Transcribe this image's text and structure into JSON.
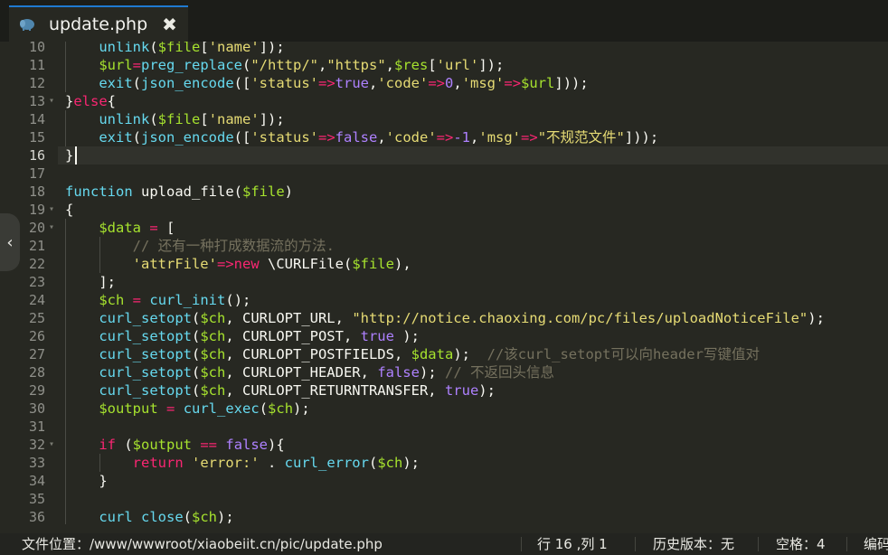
{
  "tab": {
    "title": "update.php",
    "icon": "php-elephant-icon",
    "close_glyph": "✖"
  },
  "gutter": {
    "line_numbers": [
      "10",
      "11",
      "12",
      "13",
      "14",
      "15",
      "16",
      "17",
      "18",
      "19",
      "20",
      "21",
      "22",
      "23",
      "24",
      "25",
      "26",
      "27",
      "28",
      "29",
      "30",
      "31",
      "32",
      "33",
      "34",
      "35",
      "36"
    ],
    "fold_lines": [
      "13",
      "19",
      "20",
      "32"
    ]
  },
  "editor": {
    "active_line": "16",
    "lines": [
      {
        "num": "10",
        "segments": [
          {
            "t": "    ",
            "c": "p"
          },
          {
            "t": "unlink",
            "c": "f"
          },
          {
            "t": "(",
            "c": "p"
          },
          {
            "t": "$file",
            "c": "v"
          },
          {
            "t": "[",
            "c": "p"
          },
          {
            "t": "'name'",
            "c": "s"
          },
          {
            "t": "]);",
            "c": "p"
          }
        ]
      },
      {
        "num": "11",
        "segments": [
          {
            "t": "    ",
            "c": "p"
          },
          {
            "t": "$url",
            "c": "v"
          },
          {
            "t": "=",
            "c": "k"
          },
          {
            "t": "preg_replace",
            "c": "f"
          },
          {
            "t": "(",
            "c": "p"
          },
          {
            "t": "\"/http/\"",
            "c": "s"
          },
          {
            "t": ",",
            "c": "p"
          },
          {
            "t": "\"https\"",
            "c": "s"
          },
          {
            "t": ",",
            "c": "p"
          },
          {
            "t": "$res",
            "c": "v"
          },
          {
            "t": "[",
            "c": "p"
          },
          {
            "t": "'url'",
            "c": "s"
          },
          {
            "t": "]);",
            "c": "p"
          }
        ]
      },
      {
        "num": "12",
        "segments": [
          {
            "t": "    ",
            "c": "p"
          },
          {
            "t": "exit",
            "c": "f"
          },
          {
            "t": "(",
            "c": "p"
          },
          {
            "t": "json_encode",
            "c": "f"
          },
          {
            "t": "([",
            "c": "p"
          },
          {
            "t": "'status'",
            "c": "s"
          },
          {
            "t": "=>",
            "c": "k"
          },
          {
            "t": "true",
            "c": "n"
          },
          {
            "t": ",",
            "c": "p"
          },
          {
            "t": "'code'",
            "c": "s"
          },
          {
            "t": "=>",
            "c": "k"
          },
          {
            "t": "0",
            "c": "n"
          },
          {
            "t": ",",
            "c": "p"
          },
          {
            "t": "'msg'",
            "c": "s"
          },
          {
            "t": "=>",
            "c": "k"
          },
          {
            "t": "$url",
            "c": "v"
          },
          {
            "t": "]));",
            "c": "p"
          }
        ]
      },
      {
        "num": "13",
        "segments": [
          {
            "t": "}",
            "c": "p"
          },
          {
            "t": "else",
            "c": "k"
          },
          {
            "t": "{",
            "c": "p"
          }
        ]
      },
      {
        "num": "14",
        "segments": [
          {
            "t": "    ",
            "c": "p"
          },
          {
            "t": "unlink",
            "c": "f"
          },
          {
            "t": "(",
            "c": "p"
          },
          {
            "t": "$file",
            "c": "v"
          },
          {
            "t": "[",
            "c": "p"
          },
          {
            "t": "'name'",
            "c": "s"
          },
          {
            "t": "]);",
            "c": "p"
          }
        ]
      },
      {
        "num": "15",
        "segments": [
          {
            "t": "    ",
            "c": "p"
          },
          {
            "t": "exit",
            "c": "f"
          },
          {
            "t": "(",
            "c": "p"
          },
          {
            "t": "json_encode",
            "c": "f"
          },
          {
            "t": "([",
            "c": "p"
          },
          {
            "t": "'status'",
            "c": "s"
          },
          {
            "t": "=>",
            "c": "k"
          },
          {
            "t": "false",
            "c": "n"
          },
          {
            "t": ",",
            "c": "p"
          },
          {
            "t": "'code'",
            "c": "s"
          },
          {
            "t": "=>",
            "c": "k"
          },
          {
            "t": "-1",
            "c": "n"
          },
          {
            "t": ",",
            "c": "p"
          },
          {
            "t": "'msg'",
            "c": "s"
          },
          {
            "t": "=>",
            "c": "k"
          },
          {
            "t": "\"不规范文件\"",
            "c": "s"
          },
          {
            "t": "]));",
            "c": "p"
          }
        ]
      },
      {
        "num": "16",
        "segments": [
          {
            "t": "}",
            "c": "p"
          }
        ]
      },
      {
        "num": "17",
        "segments": []
      },
      {
        "num": "18",
        "segments": [
          {
            "t": "function",
            "c": "f"
          },
          {
            "t": " ",
            "c": "p"
          },
          {
            "t": "upload_file",
            "c": "p"
          },
          {
            "t": "(",
            "c": "p"
          },
          {
            "t": "$file",
            "c": "v"
          },
          {
            "t": ")",
            "c": "p"
          }
        ]
      },
      {
        "num": "19",
        "segments": [
          {
            "t": "{",
            "c": "p"
          }
        ]
      },
      {
        "num": "20",
        "segments": [
          {
            "t": "    ",
            "c": "p"
          },
          {
            "t": "$data",
            "c": "v"
          },
          {
            "t": " ",
            "c": "p"
          },
          {
            "t": "=",
            "c": "k"
          },
          {
            "t": " [",
            "c": "p"
          }
        ]
      },
      {
        "num": "21",
        "segments": [
          {
            "t": "        ",
            "c": "p"
          },
          {
            "t": "// 还有一种打成数据流的方法.",
            "c": "c"
          }
        ]
      },
      {
        "num": "22",
        "segments": [
          {
            "t": "        ",
            "c": "p"
          },
          {
            "t": "'attrFile'",
            "c": "s"
          },
          {
            "t": "=>",
            "c": "k"
          },
          {
            "t": "new",
            "c": "k"
          },
          {
            "t": " \\CURLFile(",
            "c": "p"
          },
          {
            "t": "$file",
            "c": "v"
          },
          {
            "t": "),",
            "c": "p"
          }
        ]
      },
      {
        "num": "23",
        "segments": [
          {
            "t": "    ",
            "c": "p"
          },
          {
            "t": "];",
            "c": "p"
          }
        ]
      },
      {
        "num": "24",
        "segments": [
          {
            "t": "    ",
            "c": "p"
          },
          {
            "t": "$ch",
            "c": "v"
          },
          {
            "t": " ",
            "c": "p"
          },
          {
            "t": "=",
            "c": "k"
          },
          {
            "t": " ",
            "c": "p"
          },
          {
            "t": "curl_init",
            "c": "f"
          },
          {
            "t": "();",
            "c": "p"
          }
        ]
      },
      {
        "num": "25",
        "segments": [
          {
            "t": "    ",
            "c": "p"
          },
          {
            "t": "curl_setopt",
            "c": "f"
          },
          {
            "t": "(",
            "c": "p"
          },
          {
            "t": "$ch",
            "c": "v"
          },
          {
            "t": ", CURLOPT_URL, ",
            "c": "p"
          },
          {
            "t": "\"http://notice.chaoxing.com/pc/files/uploadNoticeFile\"",
            "c": "s"
          },
          {
            "t": ");",
            "c": "p"
          }
        ]
      },
      {
        "num": "26",
        "segments": [
          {
            "t": "    ",
            "c": "p"
          },
          {
            "t": "curl_setopt",
            "c": "f"
          },
          {
            "t": "(",
            "c": "p"
          },
          {
            "t": "$ch",
            "c": "v"
          },
          {
            "t": ", CURLOPT_POST, ",
            "c": "p"
          },
          {
            "t": "true",
            "c": "n"
          },
          {
            "t": " );",
            "c": "p"
          }
        ]
      },
      {
        "num": "27",
        "segments": [
          {
            "t": "    ",
            "c": "p"
          },
          {
            "t": "curl_setopt",
            "c": "f"
          },
          {
            "t": "(",
            "c": "p"
          },
          {
            "t": "$ch",
            "c": "v"
          },
          {
            "t": ", CURLOPT_POSTFIELDS, ",
            "c": "p"
          },
          {
            "t": "$data",
            "c": "v"
          },
          {
            "t": ");  ",
            "c": "p"
          },
          {
            "t": "//该curl_setopt可以向header写键值对",
            "c": "c"
          }
        ]
      },
      {
        "num": "28",
        "segments": [
          {
            "t": "    ",
            "c": "p"
          },
          {
            "t": "curl_setopt",
            "c": "f"
          },
          {
            "t": "(",
            "c": "p"
          },
          {
            "t": "$ch",
            "c": "v"
          },
          {
            "t": ", CURLOPT_HEADER, ",
            "c": "p"
          },
          {
            "t": "false",
            "c": "n"
          },
          {
            "t": "); ",
            "c": "p"
          },
          {
            "t": "// 不返回头信息",
            "c": "c"
          }
        ]
      },
      {
        "num": "29",
        "segments": [
          {
            "t": "    ",
            "c": "p"
          },
          {
            "t": "curl_setopt",
            "c": "f"
          },
          {
            "t": "(",
            "c": "p"
          },
          {
            "t": "$ch",
            "c": "v"
          },
          {
            "t": ", CURLOPT_RETURNTRANSFER, ",
            "c": "p"
          },
          {
            "t": "true",
            "c": "n"
          },
          {
            "t": ");",
            "c": "p"
          }
        ]
      },
      {
        "num": "30",
        "segments": [
          {
            "t": "    ",
            "c": "p"
          },
          {
            "t": "$output",
            "c": "v"
          },
          {
            "t": " ",
            "c": "p"
          },
          {
            "t": "=",
            "c": "k"
          },
          {
            "t": " ",
            "c": "p"
          },
          {
            "t": "curl_exec",
            "c": "f"
          },
          {
            "t": "(",
            "c": "p"
          },
          {
            "t": "$ch",
            "c": "v"
          },
          {
            "t": ");",
            "c": "p"
          }
        ]
      },
      {
        "num": "31",
        "segments": []
      },
      {
        "num": "32",
        "segments": [
          {
            "t": "    ",
            "c": "p"
          },
          {
            "t": "if",
            "c": "k"
          },
          {
            "t": " (",
            "c": "p"
          },
          {
            "t": "$output",
            "c": "v"
          },
          {
            "t": " ",
            "c": "p"
          },
          {
            "t": "==",
            "c": "k"
          },
          {
            "t": " ",
            "c": "p"
          },
          {
            "t": "false",
            "c": "n"
          },
          {
            "t": "){",
            "c": "p"
          }
        ]
      },
      {
        "num": "33",
        "segments": [
          {
            "t": "        ",
            "c": "p"
          },
          {
            "t": "return",
            "c": "k"
          },
          {
            "t": " ",
            "c": "p"
          },
          {
            "t": "'error:'",
            "c": "s"
          },
          {
            "t": " . ",
            "c": "p"
          },
          {
            "t": "curl_error",
            "c": "f"
          },
          {
            "t": "(",
            "c": "p"
          },
          {
            "t": "$ch",
            "c": "v"
          },
          {
            "t": ");",
            "c": "p"
          }
        ]
      },
      {
        "num": "34",
        "segments": [
          {
            "t": "    ",
            "c": "p"
          },
          {
            "t": "}",
            "c": "p"
          }
        ]
      },
      {
        "num": "35",
        "segments": []
      },
      {
        "num": "36",
        "segments": [
          {
            "t": "    ",
            "c": "p"
          },
          {
            "t": "curl_close",
            "c": "f"
          },
          {
            "t": "(",
            "c": "p"
          },
          {
            "t": "$ch",
            "c": "v"
          },
          {
            "t": ");",
            "c": "p"
          }
        ]
      }
    ]
  },
  "side_handle": {
    "glyph": "‹"
  },
  "statusbar": {
    "file_path_label": "文件位置：/www/wwwroot/xiaobeiit.cn/pic/update.php",
    "cursor_position": "行 16 ,列 1",
    "history_version": "历史版本：无",
    "indent": "空格：4",
    "encoding": "编码"
  },
  "colors": {
    "background": "#272822",
    "tab_accent": "#1f7ad1",
    "keyword": "#f92672",
    "function": "#66d9ef",
    "variable": "#a6e22e",
    "string": "#e6db74",
    "number": "#ae81ff",
    "comment": "#75715e"
  }
}
